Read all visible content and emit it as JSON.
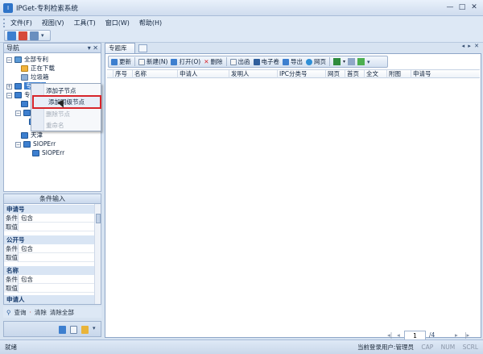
{
  "window": {
    "title": "IPGet-专利检索系统",
    "controls": [
      "—",
      "□",
      "✕"
    ]
  },
  "menu": [
    "文件(F)",
    "视图(V)",
    "工具(T)",
    "窗口(W)",
    "帮助(H)"
  ],
  "nav": {
    "title": "导航",
    "header_buttons": "▾ ✕",
    "tree": [
      {
        "label": "全部专利",
        "icon": "database-icon"
      },
      {
        "label": "正在下载",
        "icon": "download-icon"
      },
      {
        "label": "垃圾箱",
        "icon": "trash-icon"
      },
      {
        "label": "专题库",
        "icon": "folder-icon"
      },
      {
        "label": "专",
        "icon": "folder-icon"
      },
      {
        "label": "天津",
        "icon": "folder-icon"
      },
      {
        "label": "SIOPErr",
        "icon": "folder-icon"
      },
      {
        "label": "SIOPErr",
        "icon": "folder-icon"
      }
    ]
  },
  "context_menu": {
    "items": [
      {
        "label": "添加子节点",
        "enabled": true
      },
      {
        "label": "添加同级节点",
        "enabled": true,
        "highlighted": true
      },
      {
        "label": "删除节点",
        "enabled": false
      },
      {
        "label": "重命名",
        "enabled": false
      }
    ]
  },
  "conditions": {
    "title": "条件输入",
    "groups": [
      {
        "name": "申请号",
        "rows": [
          {
            "key": "条件",
            "value": "包含"
          },
          {
            "key": "取值",
            "value": ""
          }
        ]
      },
      {
        "name": "公开号",
        "rows": [
          {
            "key": "条件",
            "value": "包含"
          },
          {
            "key": "取值",
            "value": ""
          }
        ]
      },
      {
        "name": "名称",
        "rows": [
          {
            "key": "条件",
            "value": "包含"
          },
          {
            "key": "取值",
            "value": ""
          }
        ]
      },
      {
        "name": "申请人",
        "rows": []
      }
    ],
    "actions": [
      "查询",
      "清除",
      "清除全部"
    ]
  },
  "document": {
    "tab_label": "专题库",
    "toolbar": [
      "更新",
      "新建(N)",
      "打开(O)",
      "删除",
      "出函",
      "电子卷",
      "导出",
      "网页"
    ],
    "columns": [
      "序号",
      "名称",
      "申请人",
      "发明人",
      "IPC分类号",
      "网页",
      "首页",
      "全文",
      "附图",
      "申请号"
    ],
    "pager": {
      "current_page": "1",
      "total_label": "/4"
    }
  },
  "status": {
    "left": "就绪",
    "user_label": "当前登录用户:管理员",
    "indicators": [
      "CAP",
      "NUM",
      "SCRL"
    ]
  },
  "colors": {
    "accent": "#3d7fcf",
    "highlight_box": "#d7252b",
    "chrome": "#d7e3f1"
  }
}
